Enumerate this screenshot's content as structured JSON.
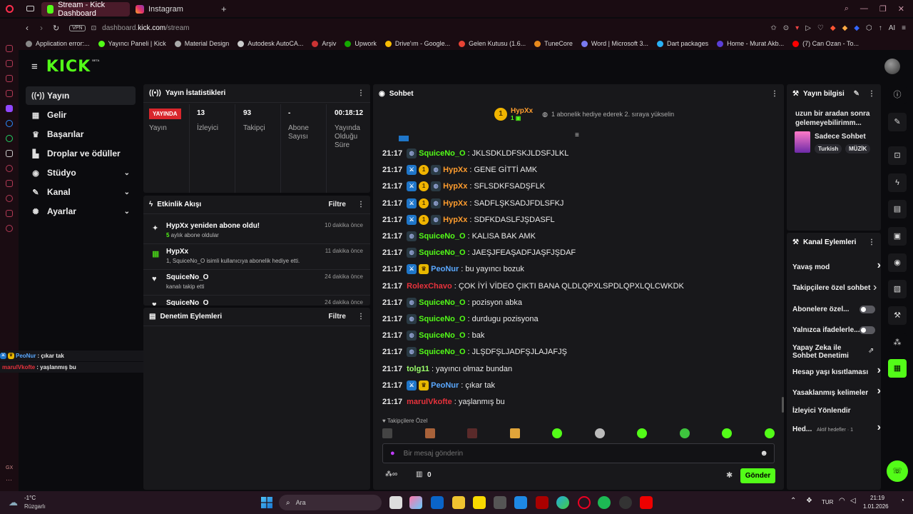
{
  "browser": {
    "tabs": [
      {
        "label": "Stream - Kick Dashboard"
      },
      {
        "label": "Instagram"
      }
    ],
    "vpn": "VPN",
    "url": "dashboard.kick.com/stream",
    "url_domain_prefix": "dashboard.",
    "url_domain": "kick.com",
    "url_path": "/stream",
    "bookmarks": [
      "Application error:...",
      "Yayıncı Paneli | Kick",
      "Material Design",
      "Autodesk AutoCA...",
      "Arşiv",
      "Upwork",
      "Drive'ım - Google...",
      "Gelen Kutusu (1.6...",
      "TuneCore",
      "Word | Microsoft 3...",
      "Dart packages",
      "Home - Murat Akb...",
      "(7) Can Ozan - To..."
    ],
    "colors": {
      "frame": "#1a0c12",
      "accent": "#53fc18",
      "live": "#d9262c"
    }
  },
  "kick": {
    "logo": "KICK",
    "beta": "BETA"
  },
  "nav": [
    {
      "label": "Yayın",
      "icon": "broadcast-icon",
      "active": true
    },
    {
      "label": "Gelir",
      "icon": "revenue-icon"
    },
    {
      "label": "Başarılar",
      "icon": "trophy-icon"
    },
    {
      "label": "Droplar ve ödüller",
      "icon": "drops-icon"
    },
    {
      "label": "Stüdyo",
      "icon": "studio-icon",
      "chevron": true
    },
    {
      "label": "Kanal",
      "icon": "channel-icon",
      "chevron": true
    },
    {
      "label": "Ayarlar",
      "icon": "settings-icon",
      "chevron": true
    }
  ],
  "stats": {
    "title": "Yayın İstatistikleri",
    "live": "YAYINDA",
    "status_label": "Yayın",
    "viewers": "13",
    "viewers_label": "İzleyici",
    "followers": "93",
    "followers_label": "Takipçi",
    "subs": "-",
    "subs_label": "Abone Sayısı",
    "uptime": "00:18:12",
    "uptime_label": "Yayında Olduğu Süre"
  },
  "activity": {
    "title": "Etkinlik Akışı",
    "filter": "Filtre",
    "items": [
      {
        "name": "HypXx yeniden abone oldu!",
        "sub": "5 aylık abone oldular",
        "time": "10 dakika önce"
      },
      {
        "name": "HypXx",
        "sub": "1, SquiceNo_O isimli kullanıcıya abonelik hediye etti.",
        "time": "11 dakika önce"
      },
      {
        "name": "SquiceNo_O",
        "sub": "kanalı takip etti",
        "time": "24 dakika önce"
      },
      {
        "name": "SquiceNo_O",
        "sub": "",
        "time": "24 dakika önce"
      }
    ]
  },
  "moderation": {
    "title": "Denetim Eylemleri",
    "filter": "Filtre"
  },
  "overlay": [
    {
      "user": "PeoNur",
      "text": ": çıkar tak"
    },
    {
      "user": "marulVkofte",
      "text": ": yaşlanmış bu"
    }
  ],
  "chat": {
    "title": "Sohbet",
    "pinned": {
      "user": "HypXx",
      "count": "1",
      "text": "1 abonelik hediye ederek 2. sıraya yükselin"
    },
    "messages": [
      {
        "time": "21:17",
        "user": "SquiceNo_O",
        "color": "#53fc18",
        "badges": [
          "gift"
        ],
        "text": ": JKLSDKLDFSKJLDSFJLKL"
      },
      {
        "time": "21:17",
        "user": "HypXx",
        "color": "#ff9d2e",
        "badges": [
          "mod",
          "sub",
          "gift"
        ],
        "text": ": GENE GİTTİ AMK"
      },
      {
        "time": "21:17",
        "user": "HypXx",
        "color": "#ff9d2e",
        "badges": [
          "mod",
          "sub",
          "gift"
        ],
        "text": ": SFLSDKFSADŞFLK"
      },
      {
        "time": "21:17",
        "user": "HypXx",
        "color": "#ff9d2e",
        "badges": [
          "mod",
          "sub",
          "gift"
        ],
        "text": ": SADFLŞKSADJFDLSFKJ"
      },
      {
        "time": "21:17",
        "user": "HypXx",
        "color": "#ff9d2e",
        "badges": [
          "mod",
          "sub",
          "gift"
        ],
        "text": ": SDFKDASLFJŞDASFL"
      },
      {
        "time": "21:17",
        "user": "SquiceNo_O",
        "color": "#53fc18",
        "badges": [
          "gift"
        ],
        "text": ": KALISA BAK AMK"
      },
      {
        "time": "21:17",
        "user": "SquiceNo_O",
        "color": "#53fc18",
        "badges": [
          "gift"
        ],
        "text": ": JAEŞJFEAŞADFJAŞFJŞDAF"
      },
      {
        "time": "21:17",
        "user": "PeoNur",
        "color": "#5aa8ff",
        "badges": [
          "mod",
          "crown"
        ],
        "text": ": bu yayıncı bozuk"
      },
      {
        "time": "21:17",
        "user": "RolexChavo",
        "color": "#e8323c",
        "badges": [],
        "text": ": ÇOK İYİ VİDEO ÇIKTI BANA QLDLQPXLSPDLQPXLQLCWKDK"
      },
      {
        "time": "21:17",
        "user": "SquiceNo_O",
        "color": "#53fc18",
        "badges": [
          "gift"
        ],
        "text": ": pozisyon abka"
      },
      {
        "time": "21:17",
        "user": "SquiceNo_O",
        "color": "#53fc18",
        "badges": [
          "gift"
        ],
        "text": ": durdugu pozisyona"
      },
      {
        "time": "21:17",
        "user": "SquiceNo_O",
        "color": "#53fc18",
        "badges": [
          "gift"
        ],
        "text": ": bak"
      },
      {
        "time": "21:17",
        "user": "SquiceNo_O",
        "color": "#53fc18",
        "badges": [
          "gift"
        ],
        "text": ": JLŞDFŞLJADFŞJLAJAFJŞ"
      },
      {
        "time": "21:17",
        "user": "tolg11",
        "color": "#9aff6a",
        "badges": [],
        "text": ": yayıncı olmaz bundan"
      },
      {
        "time": "21:17",
        "user": "PeoNur",
        "color": "#5aa8ff",
        "badges": [
          "mod",
          "crown"
        ],
        "text": ": çıkar tak"
      },
      {
        "time": "21:17",
        "user": "marulVkofte",
        "color": "#e8323c",
        "badges": [],
        "text": ": yaşlanmış bu"
      }
    ],
    "followers_only": "Takipçilere Özel",
    "placeholder": "Bir mesaj gönderin",
    "points": "0",
    "send": "Gönder"
  },
  "stream_info": {
    "title": "Yayın bilgisi",
    "stream_title": "uzun bir aradan sonra gelemeyebilirimm...",
    "category": "Sadece Sohbet",
    "tags": [
      "Turkish",
      "MÜZİK"
    ]
  },
  "channel_actions": {
    "title": "Kanal Eylemleri",
    "items": [
      {
        "label": "Yavaş mod",
        "type": "chevron"
      },
      {
        "label": "Takipçilere özel sohbet",
        "type": "chevron"
      },
      {
        "label": "Abonelere özel...",
        "type": "toggle"
      },
      {
        "label": "Yalnızca ifadelerle...",
        "type": "toggle"
      },
      {
        "label": "Yapay Zeka ile Sohbet Denetimi",
        "type": "external"
      },
      {
        "label": "Hesap yaşı kısıtlaması",
        "type": "chevron"
      },
      {
        "label": "Yasaklanmış kelimeler",
        "type": "chevron"
      },
      {
        "label": "İzleyici Yönlendir",
        "type": "none"
      },
      {
        "label": "Hed...",
        "type": "chevron",
        "extra": "Aktif hedefler · 1"
      }
    ]
  },
  "taskbar": {
    "weather_temp": "-1°C",
    "weather_text": "Rüzgarlı",
    "search": "Ara",
    "lang": "TUR",
    "time": "21:19",
    "date": "1.01.2026"
  },
  "opera_sidebar_label": "GX"
}
